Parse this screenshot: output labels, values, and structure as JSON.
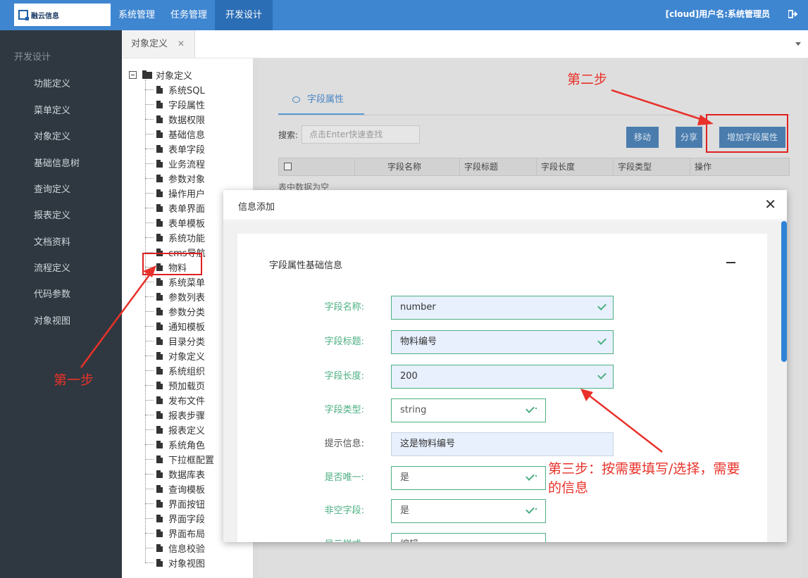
{
  "header": {
    "logo_text": "融云信息",
    "nav": [
      "系统管理",
      "任务管理",
      "开发设计"
    ],
    "user": "[cloud]用户名:系统管理员"
  },
  "sidebar": {
    "title": "开发设计",
    "items": [
      "功能定义",
      "菜单定义",
      "对象定义",
      "基础信息树",
      "查询定义",
      "报表定义",
      "文档资料",
      "流程定义",
      "代码参数",
      "对象视图"
    ]
  },
  "tabs": {
    "active": "对象定义",
    "close": "✕"
  },
  "tree": {
    "root": "对象定义",
    "items": [
      "系统SQL",
      "字段属性",
      "数据权限",
      "基础信息",
      "表单字段",
      "业务流程",
      "参数对象",
      "操作用户",
      "表单界面",
      "表单模板",
      "系统功能",
      "cms导航",
      "物料",
      "系统菜单",
      "参数列表",
      "参数分类",
      "通知模板",
      "目录分类",
      "对象定义",
      "系统组织",
      "预加载页",
      "发布文件",
      "报表步骤",
      "报表定义",
      "系统角色",
      "下拉框配置",
      "数据库表",
      "查询模板",
      "界面按钮",
      "界面字段",
      "界面布局",
      "信息校验",
      "对象视图"
    ]
  },
  "panel": {
    "tab": "字段属性",
    "search_label": "搜索:",
    "search_placeholder": "点击Enter快速查找",
    "buttons": {
      "move": "移动",
      "share": "分享",
      "add": "增加字段属性"
    },
    "columns": [
      "字段名称",
      "字段标题",
      "字段长度",
      "字段类型",
      "操作"
    ],
    "empty_text": "表中数据为空"
  },
  "modal": {
    "title": "信息添加",
    "close": "✕",
    "section_title": "字段属性基础信息",
    "fields": [
      {
        "label": "字段名称:",
        "value": "number"
      },
      {
        "label": "字段标题:",
        "value": "物料编号"
      },
      {
        "label": "字段长度:",
        "value": "200"
      },
      {
        "label": "字段类型:",
        "value": "string"
      },
      {
        "label": "提示信息:",
        "value": "这是物料编号"
      },
      {
        "label": "是否唯一:",
        "value": "是"
      },
      {
        "label": "非空字段:",
        "value": "是"
      },
      {
        "label": "显示样式:",
        "value": "编辑"
      }
    ]
  },
  "annotations": {
    "step1": "第一步",
    "step2": "第二步",
    "step3_line1": "第三步：按需要填写/选择，需要",
    "step3_line2": "的信息",
    "color": "#e8312a"
  }
}
